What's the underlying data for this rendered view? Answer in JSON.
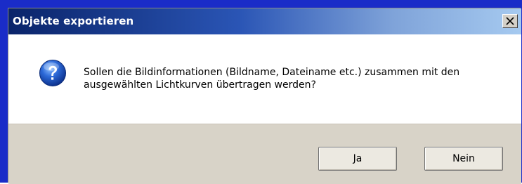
{
  "window": {
    "title": "Objekte exportieren"
  },
  "message": {
    "text": "Sollen die Bildinformationen (Bildname, Dateiname etc.) zusammen mit den ausgewählten Lichtkurven übertragen werden?",
    "icon": "question-icon"
  },
  "buttons": {
    "yes_label": "Ja",
    "no_label": "Nein"
  },
  "colors": {
    "titlebar_start": "#0a246a",
    "titlebar_end": "#a6caf0",
    "button_area": "#d8d3c8",
    "frame": "#1a2cc8"
  }
}
